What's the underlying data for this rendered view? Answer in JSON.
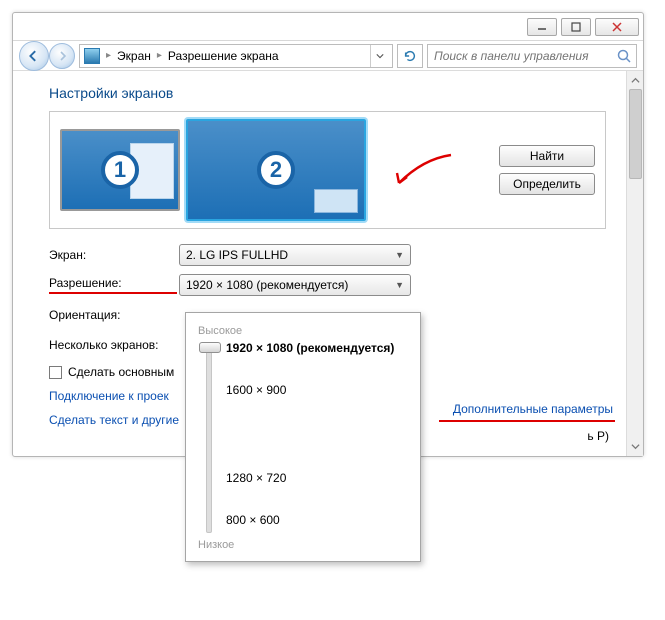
{
  "breadcrumb": {
    "seg1": "Экран",
    "seg2": "Разрешение экрана"
  },
  "search": {
    "placeholder": "Поиск в панели управления"
  },
  "heading": "Настройки экранов",
  "mon1_badge": "1",
  "mon2_badge": "2",
  "btn_find": "Найти",
  "btn_detect": "Определить",
  "labels": {
    "screen": "Экран:",
    "resolution": "Разрешение:",
    "orientation": "Ориентация:",
    "multi": "Несколько экранов:"
  },
  "screen_value": "2. LG IPS FULLHD",
  "res_value": "1920 × 1080 (рекомендуется)",
  "make_primary": "Сделать основным",
  "adv_params": "Дополнительные параметры",
  "link_projector": "Подключение к проек",
  "link_projector_suffix": "ь P)",
  "link_textsize": "Сделать текст и другие",
  "popup": {
    "high": "Высокое",
    "low": "Низкое",
    "options": [
      "1920 × 1080 (рекомендуется)",
      "1600 × 900",
      "1280 × 720",
      "800 × 600"
    ]
  }
}
